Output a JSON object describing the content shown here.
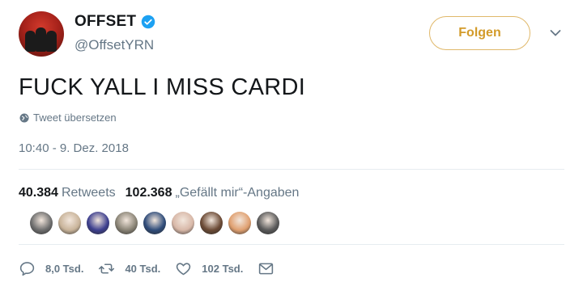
{
  "user": {
    "display_name": "OFFSET",
    "handle": "@OffsetYRN",
    "verified_icon": "verified-badge-icon"
  },
  "follow_button": {
    "label": "Folgen"
  },
  "tweet": {
    "text": "FUCK YALL I MISS CARDI",
    "translate_label": "Tweet übersetzen",
    "timestamp": "10:40 - 9. Dez. 2018"
  },
  "stats": {
    "retweets_count": "40.384",
    "retweets_label": "Retweets",
    "likes_count": "102.368",
    "likes_label": "„Gefällt mir“-Angaben"
  },
  "likers": [
    {
      "color": "#6e6e6e"
    },
    {
      "color": "#c9b49a"
    },
    {
      "color": "#3d3f8f"
    },
    {
      "color": "#8a8476"
    },
    {
      "color": "#2f4c7a"
    },
    {
      "color": "#d8b8a8"
    },
    {
      "color": "#6b4a35"
    },
    {
      "color": "#e0a070"
    },
    {
      "color": "#5a5a5a"
    }
  ],
  "actions": {
    "reply_count": "8,0 Tsd.",
    "retweet_count": "40 Tsd.",
    "like_count": "102 Tsd."
  },
  "colors": {
    "follow_accent": "#d39b2a",
    "verified": "#1da1f2",
    "secondary_text": "#657786"
  }
}
